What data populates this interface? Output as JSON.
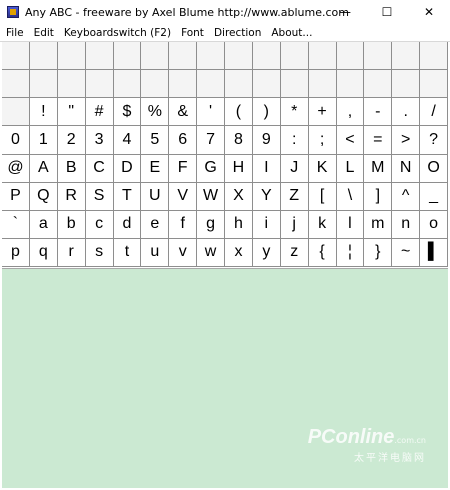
{
  "window": {
    "title": "Any ABC - freeware by Axel Blume http://www.ablume.com",
    "icon": "app-icon",
    "controls": {
      "minimize": "—",
      "maximize": "☐",
      "close": "✕"
    }
  },
  "menu": [
    "File",
    "Edit",
    "Keyboardswitch (F2)",
    "Font",
    "Direction",
    "About..."
  ],
  "grid": {
    "rows": [
      [
        "",
        "",
        "",
        "",
        "",
        "",
        "",
        "",
        "",
        "",
        "",
        "",
        "",
        "",
        "",
        ""
      ],
      [
        "",
        "",
        "",
        "",
        "",
        "",
        "",
        "",
        "",
        "",
        "",
        "",
        "",
        "",
        "",
        ""
      ],
      [
        "",
        "!",
        "\"",
        "#",
        "$",
        "%",
        "&",
        "'",
        "(",
        ")",
        "*",
        "+",
        ",",
        "-",
        ".",
        "/"
      ],
      [
        "0",
        "1",
        "2",
        "3",
        "4",
        "5",
        "6",
        "7",
        "8",
        "9",
        ":",
        ";",
        "<",
        "=",
        ">",
        "?"
      ],
      [
        "@",
        "A",
        "B",
        "C",
        "D",
        "E",
        "F",
        "G",
        "H",
        "I",
        "J",
        "K",
        "L",
        "M",
        "N",
        "O"
      ],
      [
        "P",
        "Q",
        "R",
        "S",
        "T",
        "U",
        "V",
        "W",
        "X",
        "Y",
        "Z",
        "[",
        "\\",
        "]",
        "^",
        "_"
      ],
      [
        "`",
        "a",
        "b",
        "c",
        "d",
        "e",
        "f",
        "g",
        "h",
        "i",
        "j",
        "k",
        "l",
        "m",
        "n",
        "o"
      ],
      [
        "p",
        "q",
        "r",
        "s",
        "t",
        "u",
        "v",
        "w",
        "x",
        "y",
        "z",
        "{",
        "¦",
        "}",
        "~",
        "▌"
      ]
    ]
  },
  "editor": {
    "content": ""
  },
  "watermark": {
    "brand": "PConline",
    "sub": ".com.cn",
    "cn": "太平洋电脑网"
  },
  "colors": {
    "editor_bg": "#cbe9d2",
    "grid_line": "#8e8e8e"
  }
}
